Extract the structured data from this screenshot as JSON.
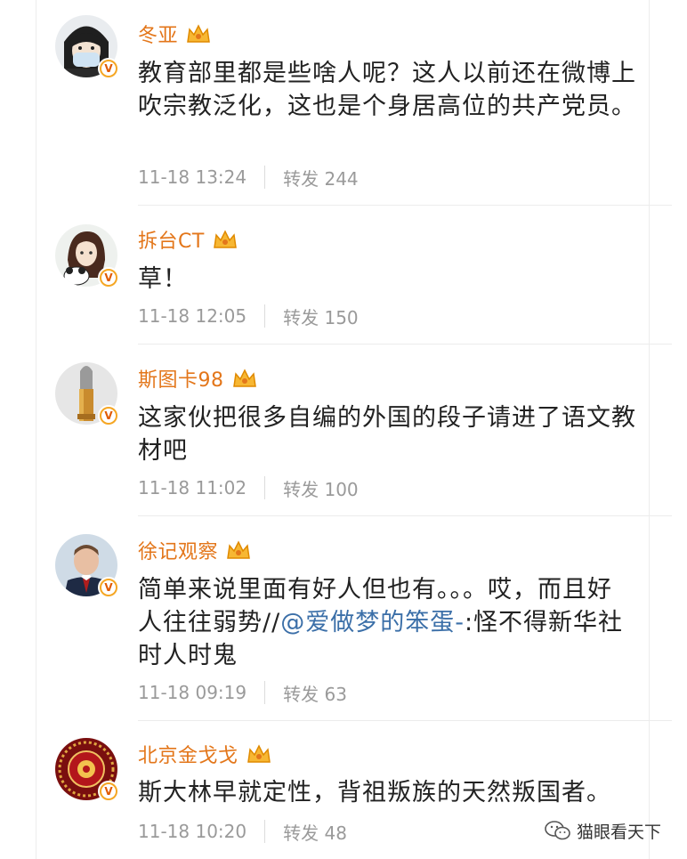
{
  "posts": [
    {
      "username": "冬亚",
      "content_parts": [
        {
          "text": "教育部里都是些啥人呢？这人以前还在微博上吹宗教泛化，这也是个身居高位的共产党员。"
        }
      ],
      "time": "11-18 13:24",
      "repost": "转发 244",
      "avatar_icon": "masked-anime-avatar"
    },
    {
      "username": "拆台CT",
      "content_parts": [
        {
          "text": "草！"
        }
      ],
      "time": "11-18 12:05",
      "repost": "转发 150",
      "avatar_icon": "anime-girl-panda-avatar"
    },
    {
      "username": "斯图卡98",
      "content_parts": [
        {
          "text": "这家伙把很多自编的外国的段子请进了语文教材吧"
        }
      ],
      "time": "11-18 11:02",
      "repost": "转发 100",
      "avatar_icon": "bullet-avatar"
    },
    {
      "username": "徐记观察",
      "content_parts": [
        {
          "text": "简单来说里面有好人但也有。。。哎，而且好人往往弱势//"
        },
        {
          "text": "@爱做梦的笨蛋-",
          "mention": true
        },
        {
          "text": ":怪不得新华社时人时鬼"
        }
      ],
      "time": "11-18 09:19",
      "repost": "转发 63",
      "avatar_icon": "man-in-suit-avatar"
    },
    {
      "username": "北京金戈戈",
      "content_parts": [
        {
          "text": "斯大林早就定性，背祖叛族的天然叛国者。"
        }
      ],
      "time": "11-18 10:20",
      "repost": "转发 48",
      "avatar_icon": "red-ornament-avatar"
    }
  ],
  "verified_badge": "V",
  "crown_icon": "vip-crown-icon",
  "watermark": {
    "text": "猫眼看天下",
    "icon": "wechat-icon"
  },
  "colors": {
    "username": "#e3761a",
    "mention": "#3b6fa8",
    "meta": "#9a9a9a",
    "badge": "#f5a623"
  }
}
